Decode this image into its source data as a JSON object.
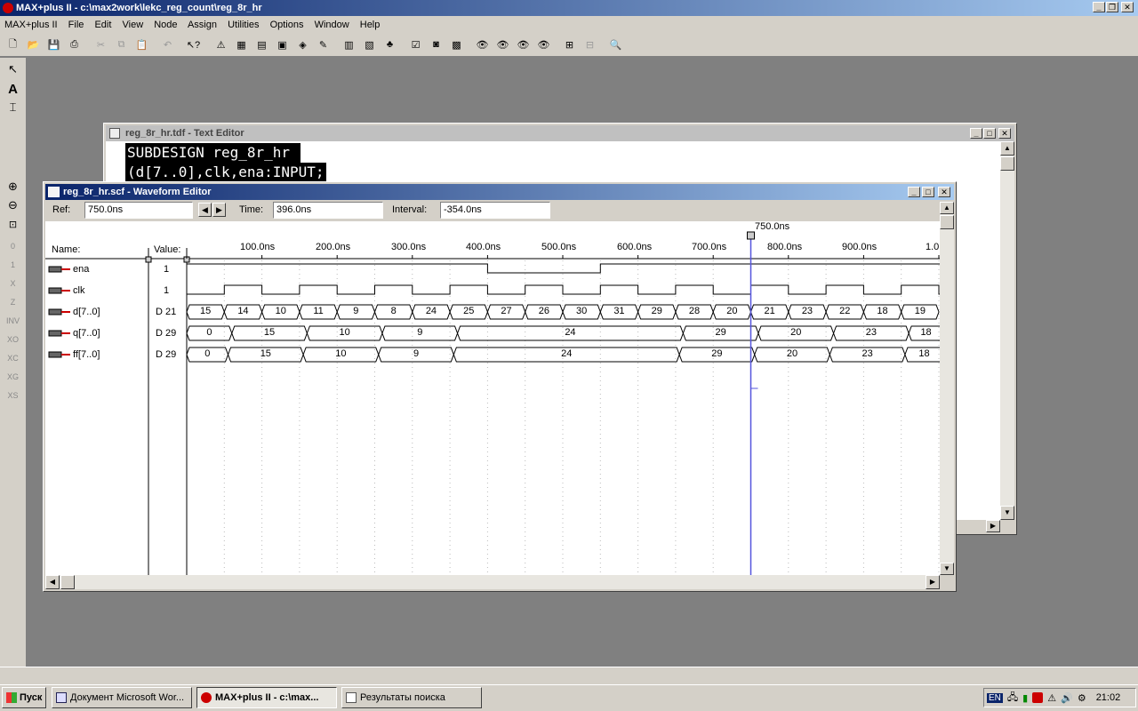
{
  "app_title": "MAX+plus II - c:\\max2work\\lekc_reg_count\\reg_8r_hr",
  "menu": [
    "MAX+plus II",
    "File",
    "Edit",
    "View",
    "Node",
    "Assign",
    "Utilities",
    "Options",
    "Window",
    "Help"
  ],
  "text_editor": {
    "title": "reg_8r_hr.tdf - Text Editor",
    "lines": [
      "SUBDESIGN reg_8r_hr ",
      "(d[7..0],clk,ena:INPUT;"
    ]
  },
  "waveform_editor": {
    "title": "reg_8r_hr.scf - Waveform Editor",
    "ref_label": "Ref:",
    "ref_value": "750.0ns",
    "time_label": "Time:",
    "time_value": "396.0ns",
    "interval_label": "Interval:",
    "interval_value": "-354.0ns",
    "cursor_label": "750.0ns",
    "name_header": "Name:",
    "value_header": "Value:",
    "ticks": [
      "100.0ns",
      "200.0ns",
      "300.0ns",
      "400.0ns",
      "500.0ns",
      "600.0ns",
      "700.0ns",
      "800.0ns",
      "900.0ns",
      "1.0"
    ],
    "signals": [
      {
        "name": "ena",
        "value": "1"
      },
      {
        "name": "clk",
        "value": "1"
      },
      {
        "name": "d[7..0]",
        "value": "D 21"
      },
      {
        "name": "q[7..0]",
        "value": "D 29"
      },
      {
        "name": "ff[7..0]",
        "value": "D 29"
      }
    ],
    "d_values": [
      "15",
      "14",
      "10",
      "11",
      "9",
      "8",
      "24",
      "25",
      "27",
      "26",
      "30",
      "31",
      "29",
      "28",
      "20",
      "21",
      "23",
      "22",
      "18",
      "19"
    ],
    "q_values": [
      "0",
      "15",
      "10",
      "9",
      "24",
      "29",
      "20",
      "23",
      "18"
    ],
    "ff_values": [
      "0",
      "15",
      "10",
      "9",
      "24",
      "29",
      "20",
      "23",
      "18"
    ]
  },
  "taskbar": {
    "start": "Пуск",
    "tasks": [
      "Документ Microsoft Wor...",
      "MAX+plus II - c:\\max...",
      "Результаты поиска"
    ],
    "lang": "EN",
    "clock": "21:02"
  }
}
